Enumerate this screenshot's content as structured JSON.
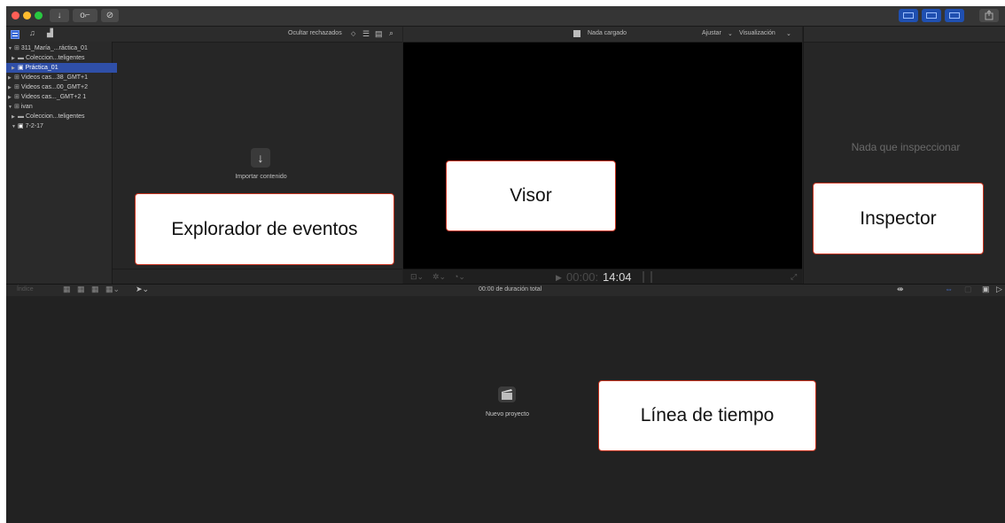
{
  "titlebar": {
    "download_icon": "↓",
    "key_icon": "o⌐",
    "check_icon": "⊘"
  },
  "browser": {
    "hide_rejected_label": "Ocultar rechazados",
    "library_items": [
      {
        "label": "311_María_...ráctica_01",
        "indent": 0,
        "expanded": true,
        "icon": "library-icon",
        "selected": false
      },
      {
        "label": "Coleccion...teligentes",
        "indent": 1,
        "expanded": false,
        "icon": "folder-icon",
        "selected": false
      },
      {
        "label": "Práctica_01",
        "indent": 1,
        "expanded": false,
        "icon": "event-icon",
        "selected": true
      },
      {
        "label": "Videos cas...38_GMT+1",
        "indent": 0,
        "expanded": false,
        "icon": "library-icon",
        "selected": false
      },
      {
        "label": "Videos cas...00_GMT+2",
        "indent": 0,
        "expanded": false,
        "icon": "library-icon",
        "selected": false
      },
      {
        "label": "Videos cas..._GMT+2 1",
        "indent": 0,
        "expanded": false,
        "icon": "library-icon",
        "selected": false
      },
      {
        "label": "ivan",
        "indent": 0,
        "expanded": true,
        "icon": "library-icon",
        "selected": false
      },
      {
        "label": "Coleccion...teligentes",
        "indent": 1,
        "expanded": false,
        "icon": "folder-icon",
        "selected": false
      },
      {
        "label": "7-2-17",
        "indent": 1,
        "expanded": true,
        "icon": "event-icon",
        "selected": false
      }
    ],
    "import_label": "Importar contenido",
    "import_icon": "↓"
  },
  "viewer": {
    "status_label": "Nada cargado",
    "fit_label": "Ajustar",
    "view_label": "Visualización",
    "timecode_dim": "00:00:",
    "timecode_main": "14:04"
  },
  "inspector": {
    "empty_text": "Nada que inspeccionar"
  },
  "timeline_toolbar": {
    "index_label": "Índice",
    "duration_label": "00:00 de duración total"
  },
  "timeline": {
    "new_project_label": "Nuevo proyecto"
  },
  "callouts": {
    "browser": "Explorador de eventos",
    "viewer": "Visor",
    "inspector": "Inspector",
    "timeline": "Línea de tiempo"
  },
  "colors": {
    "close": "#ff5f57",
    "minimize": "#febc2e",
    "zoom": "#28c840",
    "accent": "#2f4fa8",
    "callout_border": "#c8331f"
  }
}
